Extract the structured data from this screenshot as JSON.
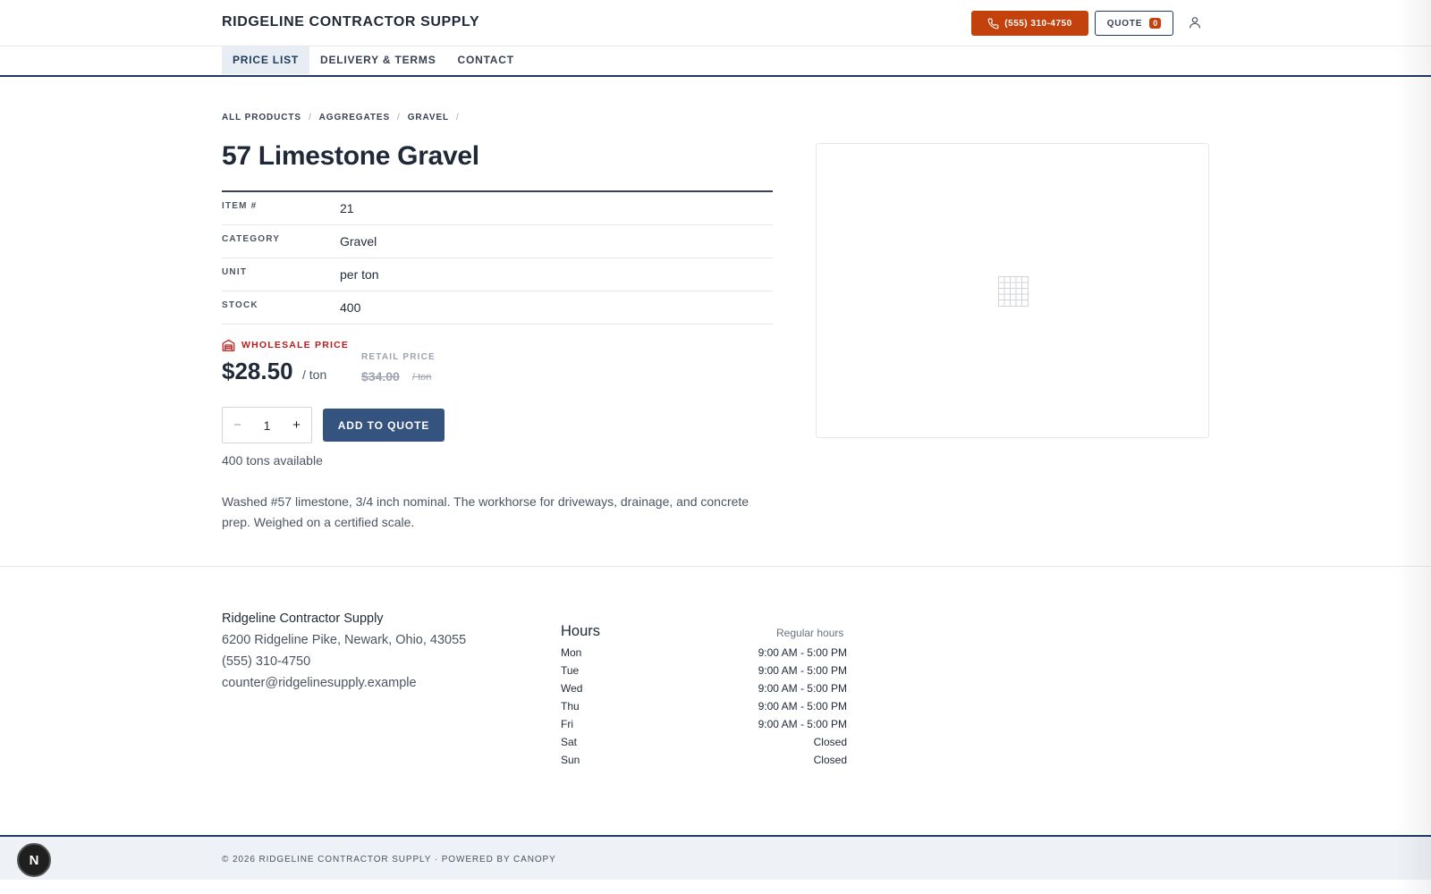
{
  "header": {
    "brand": "RIDGELINE CONTRACTOR SUPPLY",
    "phone_label": "(555) 310-4750",
    "quote_label": "QUOTE",
    "quote_count": "0"
  },
  "nav": {
    "tabs": [
      {
        "label": "PRICE LIST",
        "active": true
      },
      {
        "label": "DELIVERY & TERMS"
      },
      {
        "label": "CONTACT"
      }
    ]
  },
  "breadcrumb": [
    "ALL PRODUCTS",
    "AGGREGATES",
    "GRAVEL"
  ],
  "breadcrumb_sep": "/",
  "product": {
    "title": "57 Limestone Gravel",
    "specs": [
      {
        "label": "ITEM #",
        "value": "21"
      },
      {
        "label": "CATEGORY",
        "value": "Gravel"
      },
      {
        "label": "UNIT",
        "value": "per ton"
      },
      {
        "label": "STOCK",
        "value": "400"
      }
    ],
    "wholesale_label": "WHOLESALE PRICE",
    "wholesale_price": "$28.50",
    "wholesale_unit": "/ ton",
    "retail_label": "RETAIL PRICE",
    "retail_price": "$34.00",
    "retail_unit": "/ ton",
    "quantity": "1",
    "minus": "−",
    "plus": "+",
    "add_label": "ADD TO QUOTE",
    "available": "400 tons available",
    "description": "Washed #57 limestone, 3/4 inch nominal. The workhorse for driveways, drainage, and concrete prep. Weighed on a certified scale."
  },
  "footer": {
    "name": "Ridgeline Contractor Supply",
    "address": "6200 Ridgeline Pike, Newark, Ohio, 43055",
    "phone": "(555) 310-4750",
    "email": "counter@ridgelinesupply.example",
    "hours_title": "Hours",
    "hours_sub": "Regular hours",
    "hours": [
      {
        "day": "Mon",
        "time": "9:00 AM - 5:00 PM"
      },
      {
        "day": "Tue",
        "time": "9:00 AM - 5:00 PM"
      },
      {
        "day": "Wed",
        "time": "9:00 AM - 5:00 PM"
      },
      {
        "day": "Thu",
        "time": "9:00 AM - 5:00 PM"
      },
      {
        "day": "Fri",
        "time": "9:00 AM - 5:00 PM"
      },
      {
        "day": "Sat",
        "time": "Closed"
      },
      {
        "day": "Sun",
        "time": "Closed"
      }
    ],
    "copyright": "© 2026 RIDGELINE CONTRACTOR SUPPLY · POWERED BY CANOPY"
  },
  "dev_badge": "N",
  "icons": {
    "phone": "phone-icon",
    "user": "user-icon",
    "warehouse": "warehouse-icon",
    "image_placeholder": "image-placeholder-icon"
  },
  "colors": {
    "accent": "#c2410c",
    "navy": "#1e3a5f",
    "button": "#35537f",
    "wholesale": "#b91c1c"
  }
}
